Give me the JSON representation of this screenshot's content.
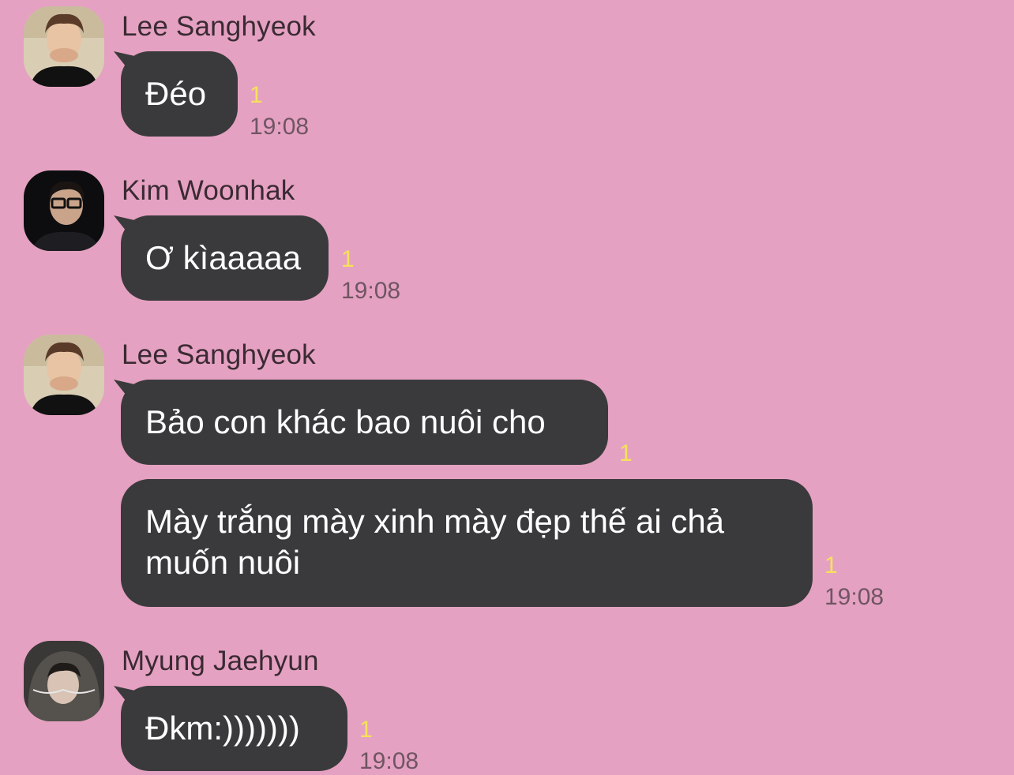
{
  "messages": [
    {
      "sender": "Lee Sanghyeok",
      "avatar_icon": "profile-photo-lee-sanghyeok",
      "bubbles": [
        {
          "text": "Đéo",
          "unread": "1",
          "time": "19:08"
        }
      ]
    },
    {
      "sender": "Kim Woonhak",
      "avatar_icon": "profile-photo-kim-woonhak",
      "bubbles": [
        {
          "text": "Ơ kìaaaaa",
          "unread": "1",
          "time": "19:08"
        }
      ]
    },
    {
      "sender": "Lee Sanghyeok",
      "avatar_icon": "profile-photo-lee-sanghyeok",
      "bubbles": [
        {
          "text": "Bảo con khác bao nuôi cho",
          "unread": "1"
        },
        {
          "line1": "Mày trắng mày xinh mày đẹp thế ai chả",
          "line2": "muốn nuôi",
          "unread": "1",
          "time": "19:08"
        }
      ]
    },
    {
      "sender": "Myung Jaehyun",
      "avatar_icon": "profile-photo-myung-jaehyun",
      "bubbles": [
        {
          "text": "Đkm:)))))))",
          "unread": "1",
          "time": "19:08"
        }
      ]
    }
  ],
  "colors": {
    "background": "#e5a1c1",
    "bubble": "#3a3a3c",
    "bubble_text": "#ffffff",
    "unread": "#f5e25a",
    "time": "#6f5563"
  }
}
